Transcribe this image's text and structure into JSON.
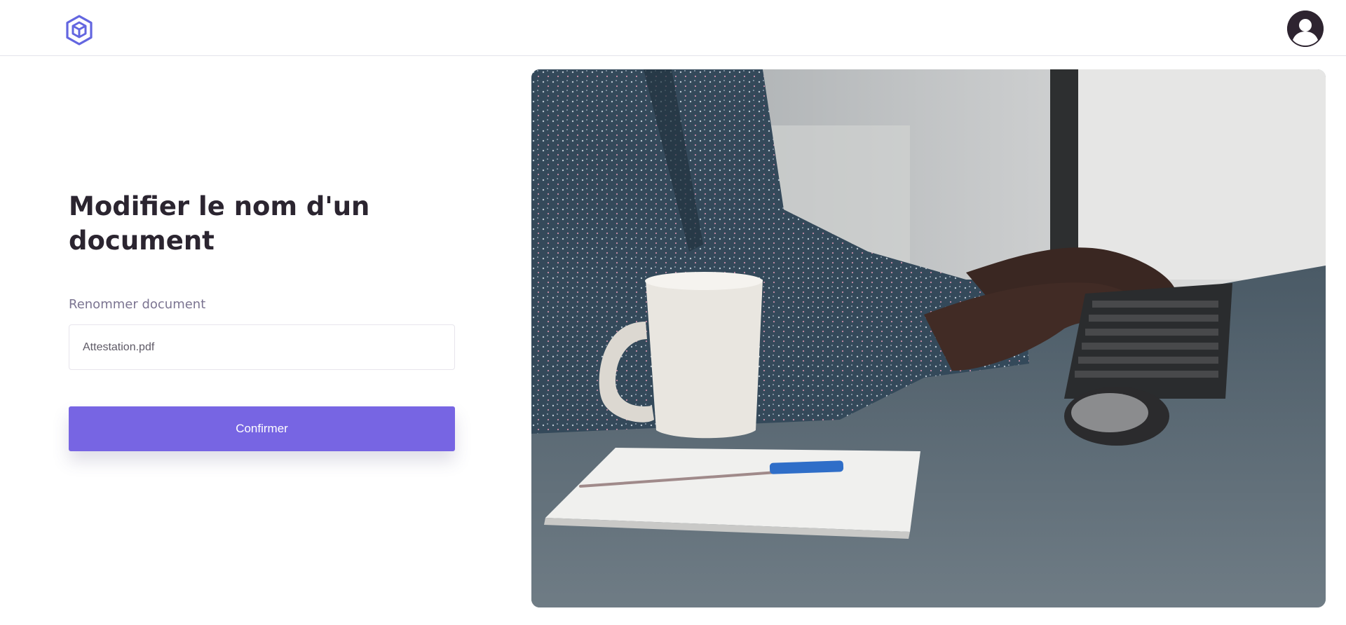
{
  "header": {
    "logo_icon": "hexagon-cube-logo",
    "avatar_icon": "user-avatar-icon",
    "brand_color": "#6366e0"
  },
  "main": {
    "title": "Modifier le nom d'un document",
    "field_label": "Renommer document",
    "input_value": "Attestation.pdf",
    "confirm_label": "Confirmer",
    "accent_color": "#7765e3"
  },
  "hero": {
    "image": "photo-person-typing-at-desk-with-mug-and-notebook"
  }
}
